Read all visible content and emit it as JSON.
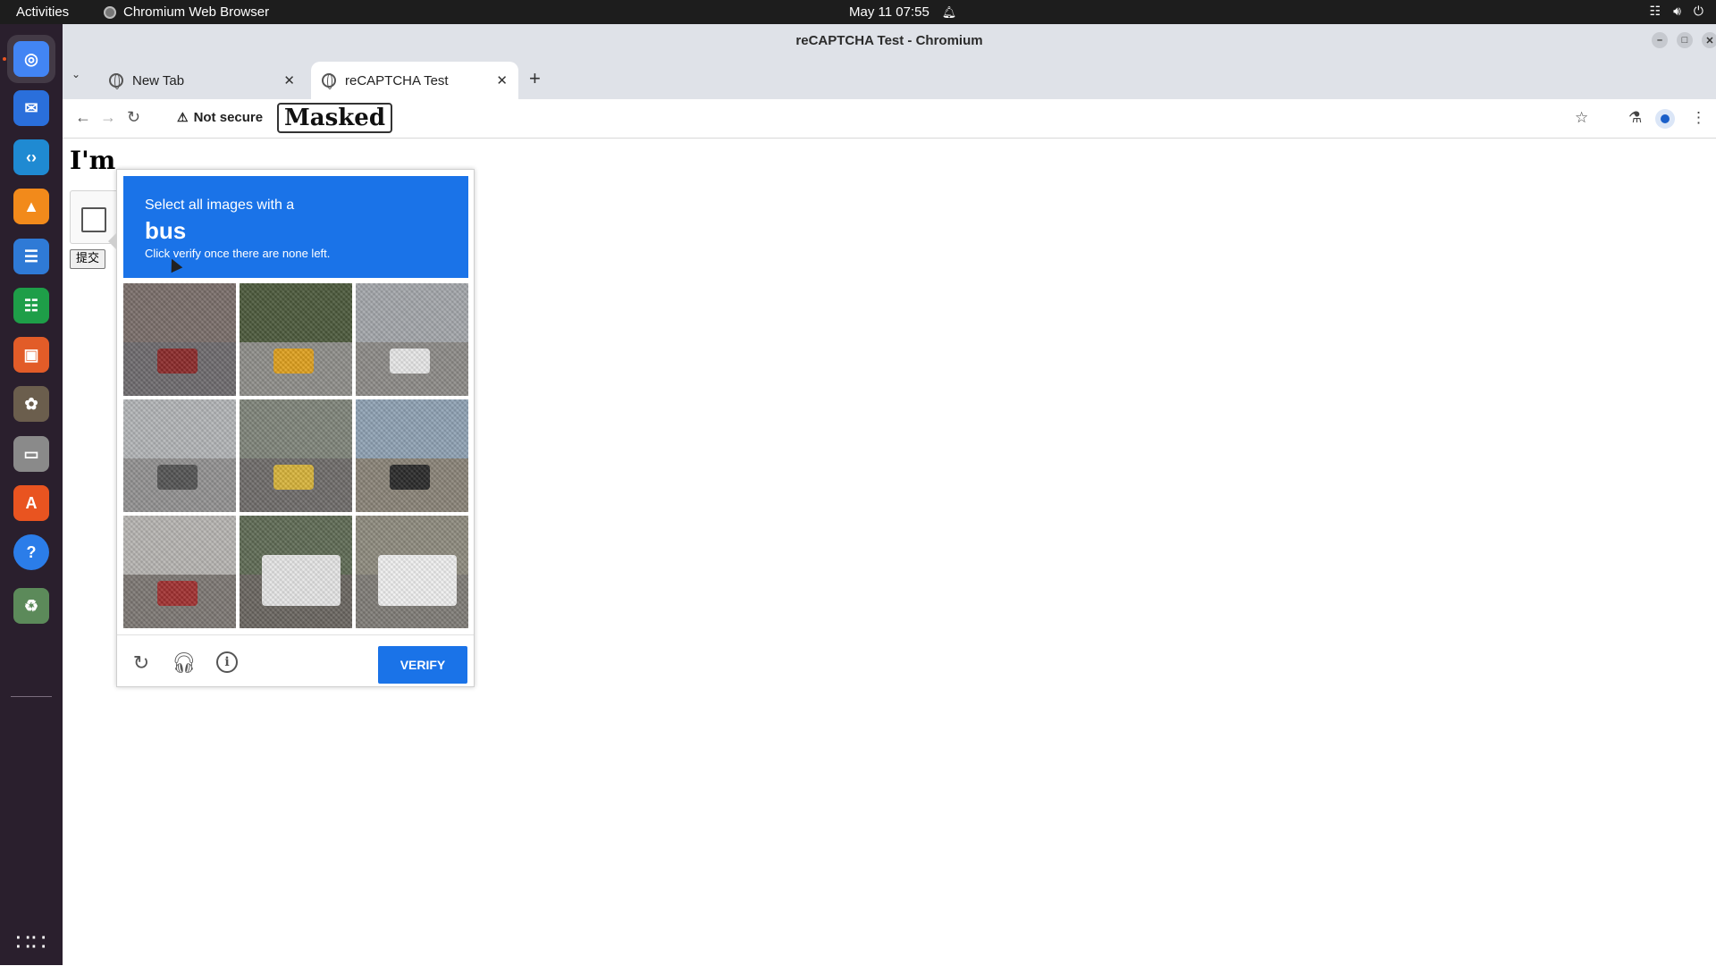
{
  "topbar": {
    "activities": "Activities",
    "app_name": "Chromium Web Browser",
    "datetime": "May 11  07:55"
  },
  "dock": {
    "items": [
      {
        "name": "chromium-icon",
        "color": "#4285f4"
      },
      {
        "name": "thunderbird-icon",
        "color": "#2a6fdb"
      },
      {
        "name": "vscode-icon",
        "color": "#1f8ad2"
      },
      {
        "name": "vlc-icon",
        "color": "#f28a1b"
      },
      {
        "name": "writer-icon",
        "color": "#2f7ad6"
      },
      {
        "name": "calc-icon",
        "color": "#1e9e48"
      },
      {
        "name": "impress-icon",
        "color": "#e25c28"
      },
      {
        "name": "gimp-icon",
        "color": "#6b5e4d"
      },
      {
        "name": "files-icon",
        "color": "#8a8a8a"
      },
      {
        "name": "appcenter-icon",
        "color": "#e95420"
      },
      {
        "name": "help-icon",
        "color": "#2b7de9"
      },
      {
        "name": "trash-icon",
        "color": "#5c8a5a"
      }
    ]
  },
  "window": {
    "title": "reCAPTCHA Test - Chromium"
  },
  "tabs": [
    {
      "label": "New Tab"
    },
    {
      "label": "reCAPTCHA Test"
    }
  ],
  "toolbar": {
    "security_label": "Not secure",
    "url_masked": "Masked"
  },
  "page": {
    "heading": "I'm",
    "submit_label": "提交"
  },
  "challenge": {
    "line1": "Select all images with a",
    "object": "bus",
    "line2": "Click verify once there are none left.",
    "verify_label": "VERIFY",
    "tiles": [
      {
        "name": "tile-car-rear",
        "sky": "#7a6e6a",
        "road": "#6e6b6e",
        "obj": "#8c2a2a"
      },
      {
        "name": "tile-school-bus",
        "sky": "#4c5a3c",
        "road": "#8f8e8a",
        "obj": "#e0a11e"
      },
      {
        "name": "tile-street-car",
        "sky": "#a4a7ab",
        "road": "#8d8b88",
        "obj": "#e8e8e8"
      },
      {
        "name": "tile-highway",
        "sky": "#b3b5b7",
        "road": "#939292",
        "obj": "#555555"
      },
      {
        "name": "tile-road-lines",
        "sky": "#7f857a",
        "road": "#6f6c6a",
        "obj": "#d8b43a"
      },
      {
        "name": "tile-traffic-lights",
        "sky": "#8fa2b4",
        "road": "#8a8478",
        "obj": "#2a2a2a"
      },
      {
        "name": "tile-city-street",
        "sky": "#b7b5b2",
        "road": "#7d7874",
        "obj": "#a23030"
      },
      {
        "name": "tile-transit-bus",
        "sky": "#5f6b55",
        "road": "#6a6660",
        "obj": "#e6e6e6"
      },
      {
        "name": "tile-coach-bus",
        "sky": "#8e8b7e",
        "road": "#7f7c77",
        "obj": "#f0f0f0"
      }
    ]
  }
}
